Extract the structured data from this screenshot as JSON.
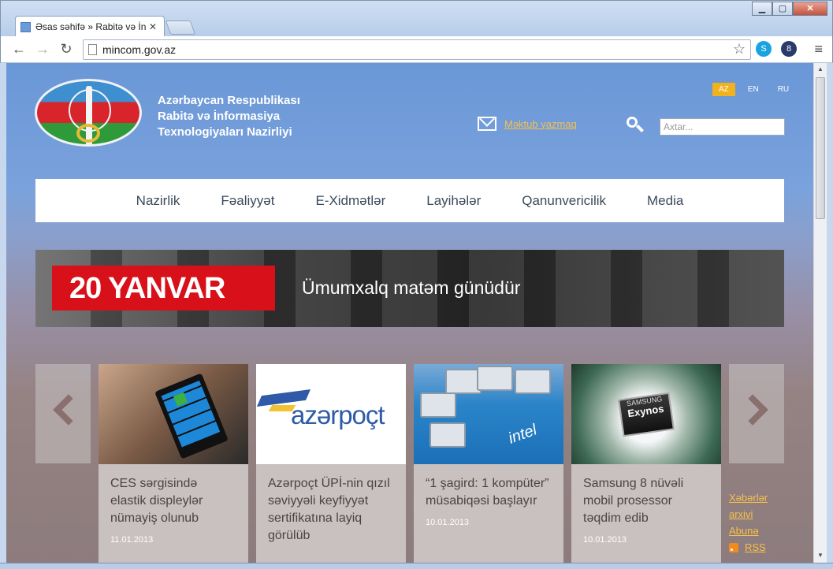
{
  "browser": {
    "tab_title": "Əsas səhifə » Rabitə və İnf",
    "tab_close": "✕",
    "url": "mincom.gov.az",
    "back": "←",
    "forward": "→",
    "reload": "↻",
    "star": "☆",
    "menu": "≡",
    "win_min": "▁",
    "win_max": "▢",
    "win_close": "✕"
  },
  "header": {
    "ministry_line1": "Azərbaycan Respublikası",
    "ministry_line2": "Rabitə və İnformasiya",
    "ministry_line3": "Texnologiyaları Nazirliyi",
    "languages": [
      "AZ",
      "EN",
      "RU"
    ],
    "mail_link": "Məktub yazmaq",
    "search_placeholder": "Axtar..."
  },
  "nav": [
    "Nazirlik",
    "Fəaliyyət",
    "E-Xidmətlər",
    "Layihələr",
    "Qanunvericilik",
    "Media"
  ],
  "banner": {
    "title": "20 YANVAR",
    "subtitle": "Ümumxalq matəm günüdür"
  },
  "news": [
    {
      "headline": "CES sərgisində elastik displeylər nümayiş olunub",
      "date": "11.01.2013"
    },
    {
      "headline": "Azərpoçt ÜPİ-nin qızıl səviyyəli keyfiyyət sertifikatına layiq görülüb",
      "date": ""
    },
    {
      "headline": "“1 şagird: 1 kompüter” müsabiqəsi başlayır",
      "date": "10.01.2013"
    },
    {
      "headline": "Samsung 8 nüvəli mobil prosessor təqdim edib",
      "date": "10.01.2013"
    }
  ],
  "images": {
    "azerpost_brand": "azərpoçt",
    "intel_text": "intel",
    "chip_brand": "SAMSUNG",
    "chip_name": "Exynos"
  },
  "side_links": {
    "archive": "Xəbərlər arxivi",
    "subscribe": "Abunə",
    "rss": "RSS"
  },
  "colors": {
    "accent": "#f2b21b",
    "link": "#f6c04a",
    "banner_red": "#d7101a"
  }
}
